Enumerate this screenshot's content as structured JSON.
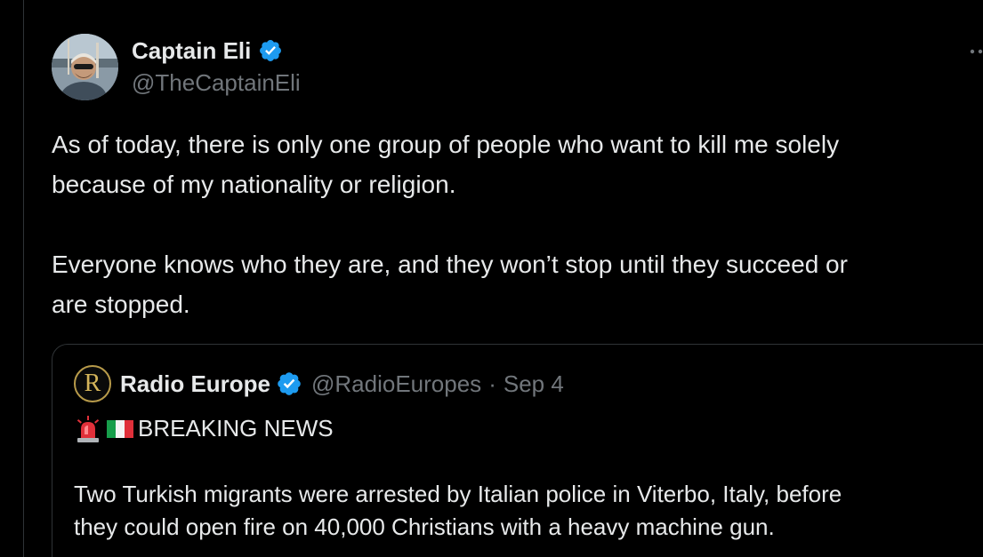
{
  "tweet": {
    "author": {
      "display_name": "Captain Eli",
      "handle": "@TheCaptainEli",
      "verified": true,
      "avatar_icon": "profile-photo"
    },
    "text": {
      "paragraph1_line1": "As of today, there is only one group of people who want to kill me solely",
      "paragraph1_line2": "because of my nationality or religion.",
      "paragraph2_line1": "Everyone knows who they are, and they won’t stop until they succeed or",
      "paragraph2_line2": "are stopped."
    },
    "more_icon": "more-dots-icon"
  },
  "quote": {
    "author": {
      "display_name": "Radio Europe",
      "handle": "@RadioEuropes",
      "separator": "·",
      "date": "Sep 4",
      "avatar_letter": "R",
      "verified": true
    },
    "headline_emojis": [
      "police-light-icon",
      "italy-flag-icon"
    ],
    "headline": "BREAKING NEWS",
    "body_line1": "Two Turkish migrants were arrested by Italian police in Viterbo, Italy, before",
    "body_line2": "they could open fire on 40,000 Christians with a heavy machine gun."
  },
  "colors": {
    "background": "#000000",
    "text_primary": "#e7e9ea",
    "text_secondary": "#71767b",
    "border": "#2f3336",
    "verified_blue": "#1d9bf0"
  }
}
